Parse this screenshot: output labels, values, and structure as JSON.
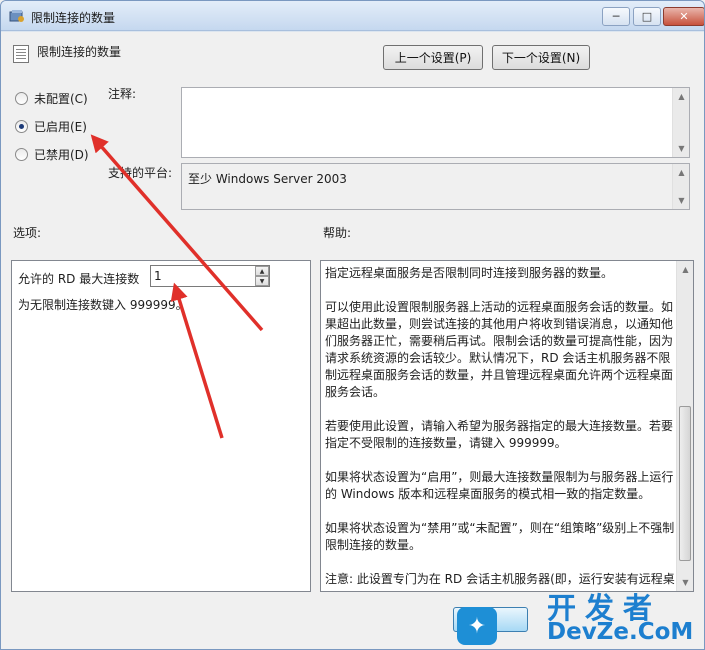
{
  "window": {
    "title": "限制连接的数量",
    "controls": {
      "minimize": "─",
      "maximize": "□",
      "close": "✕"
    }
  },
  "policy": {
    "title": "限制连接的数量"
  },
  "nav": {
    "prev_label": "上一个设置(P)",
    "next_label": "下一个设置(N)"
  },
  "state": {
    "options": [
      {
        "label": "未配置(C)",
        "checked": false
      },
      {
        "label": "已启用(E)",
        "checked": true
      },
      {
        "label": "已禁用(D)",
        "checked": false
      }
    ]
  },
  "comment": {
    "label": "注释:",
    "value": ""
  },
  "platform": {
    "label": "支持的平台:",
    "value": "至少 Windows Server 2003"
  },
  "options_section": {
    "label": "选项:",
    "max_connections_label": "允许的 RD 最大连接数",
    "max_connections_value": "1",
    "hint": "为无限制连接数键入 999999。"
  },
  "help_section": {
    "label": "帮助:",
    "paragraphs": [
      "指定远程桌面服务是否限制同时连接到服务器的数量。",
      "可以使用此设置限制服务器上活动的远程桌面服务会话的数量。如果超出此数量，则尝试连接的其他用户将收到错误消息，以通知他们服务器正忙，需要稍后再试。限制会话的数量可提高性能，因为请求系统资源的会话较少。默认情况下，RD 会话主机服务器不限制远程桌面服务会话的数量，并且管理远程桌面允许两个远程桌面服务会话。",
      "若要使用此设置，请输入希望为服务器指定的最大连接数量。若要指定不受限制的连接数量，请键入 999999。",
      "如果将状态设置为“启用”，则最大连接数量限制为与服务器上运行的 Windows 版本和远程桌面服务的模式相一致的指定数量。",
      "如果将状态设置为“禁用”或“未配置”，则在“组策略”级别上不强制限制连接的数量。",
      "注意: 此设置专门为在 RD 会话主机服务器(即，运行安装有远程桌"
    ]
  },
  "footer": {
    "ok_label": "定"
  },
  "watermark": {
    "logo_text": "✦",
    "cn": "开发者",
    "en": "DevZe.CoM"
  },
  "colors": {
    "arrow": "#e0302a",
    "accent": "#1d7fcf"
  }
}
